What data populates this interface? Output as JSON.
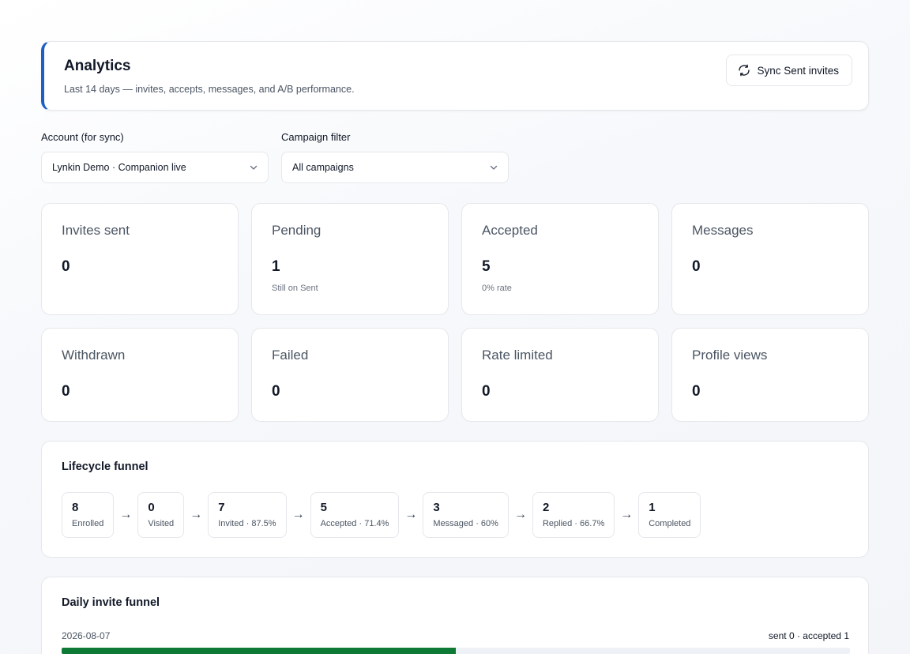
{
  "header": {
    "title": "Analytics",
    "subtitle": "Last 14 days — invites, accepts, messages, and A/B performance.",
    "sync_label": "Sync Sent invites"
  },
  "filters": {
    "account": {
      "label": "Account (for sync)",
      "value": "Lynkin Demo · Companion live"
    },
    "campaign": {
      "label": "Campaign filter",
      "value": "All campaigns"
    }
  },
  "stats": {
    "invites_sent": {
      "label": "Invites sent",
      "value": "0"
    },
    "pending": {
      "label": "Pending",
      "value": "1",
      "note": "Still on Sent"
    },
    "accepted": {
      "label": "Accepted",
      "value": "5",
      "note": "0% rate"
    },
    "messages": {
      "label": "Messages",
      "value": "0"
    },
    "withdrawn": {
      "label": "Withdrawn",
      "value": "0"
    },
    "failed": {
      "label": "Failed",
      "value": "0"
    },
    "rate_limited": {
      "label": "Rate limited",
      "value": "0"
    },
    "profile_views": {
      "label": "Profile views",
      "value": "0"
    }
  },
  "lifecycle": {
    "title": "Lifecycle funnel",
    "arrow": "→",
    "steps": [
      {
        "count": "8",
        "label": "Enrolled"
      },
      {
        "count": "0",
        "label": "Visited"
      },
      {
        "count": "7",
        "label": "Invited · 87.5%"
      },
      {
        "count": "5",
        "label": "Accepted · 71.4%"
      },
      {
        "count": "3",
        "label": "Messaged · 60%"
      },
      {
        "count": "2",
        "label": "Replied · 66.7%"
      },
      {
        "count": "1",
        "label": "Completed"
      }
    ]
  },
  "daily": {
    "title": "Daily invite funnel",
    "rows": [
      {
        "date": "2026-08-07",
        "summary": "sent 0 · accepted 1",
        "fill_fraction": 0.5
      }
    ]
  },
  "colors": {
    "accent": "#1d5fc2",
    "bar_fill": "#0f7a35",
    "bar_track": "#eef1f5",
    "border": "#e5e7eb"
  }
}
